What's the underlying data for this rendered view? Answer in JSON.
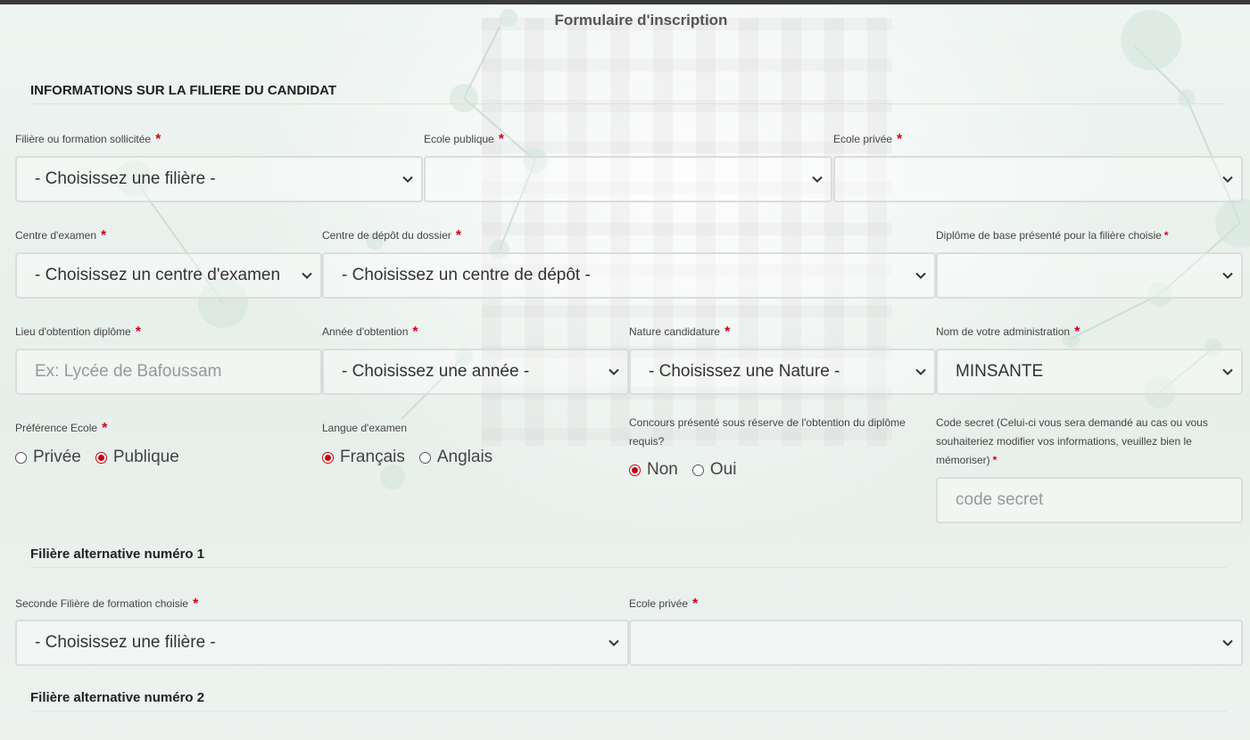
{
  "page_title": "Formulaire d'inscription",
  "sections": {
    "main": "INFORMATIONS SUR LA FILIERE DU CANDIDAT",
    "alt1": "Filière alternative numéro 1",
    "alt2": "Filière alternative numéro 2"
  },
  "fields": {
    "filiere": {
      "label": "Filière ou formation sollicitée",
      "value": "- Choisissez une filière -"
    },
    "ecole_publique": {
      "label": "Ecole publique",
      "value": ""
    },
    "ecole_privee": {
      "label": "Ecole privée",
      "value": ""
    },
    "centre_examen": {
      "label": "Centre d'examen",
      "value": "- Choisissez un centre d'examen"
    },
    "centre_depot": {
      "label": "Centre de dépôt du dossier",
      "value": "- Choisissez un centre de dépôt -"
    },
    "diplome_base": {
      "label": "Diplôme de base présenté pour la filière choisie",
      "value": ""
    },
    "lieu_obtention": {
      "label": "Lieu d'obtention diplôme",
      "value": "",
      "placeholder": "Ex: Lycée de Bafoussam"
    },
    "annee_obtention": {
      "label": "Année d'obtention",
      "value": "- Choisissez une année -"
    },
    "nature_candidature": {
      "label": "Nature candidature",
      "value": "- Choisissez une Nature -"
    },
    "administration": {
      "label": "Nom de votre administration",
      "value": "MINSANTE"
    },
    "preference_ecole": {
      "label": "Préférence Ecole",
      "options": [
        "Privée",
        "Publique"
      ],
      "selected": "Publique"
    },
    "langue_examen": {
      "label": "Langue d'examen",
      "options": [
        "Français",
        "Anglais"
      ],
      "selected": "Français"
    },
    "concours_reserve": {
      "label": "Concours présenté sous réserve de l'obtention du diplôme requis?",
      "options": [
        "Non",
        "Oui"
      ],
      "selected": "Non"
    },
    "code_secret": {
      "label": "Code secret (Celui-ci vous sera demandé au cas ou vous souhaiteriez modifier vos informations, veuillez bien le mémoriser)",
      "value": "",
      "placeholder": "code secret"
    },
    "seconde_filiere": {
      "label": "Seconde Filière de formation choisie",
      "value": "- Choisissez une filière -"
    },
    "ecole_privee_alt1": {
      "label": "Ecole privée",
      "value": ""
    }
  },
  "required_mark": "*",
  "colors": {
    "required": "#d0021b",
    "radio_selected": "#c0000f",
    "topbar": "#3a3a3a"
  }
}
